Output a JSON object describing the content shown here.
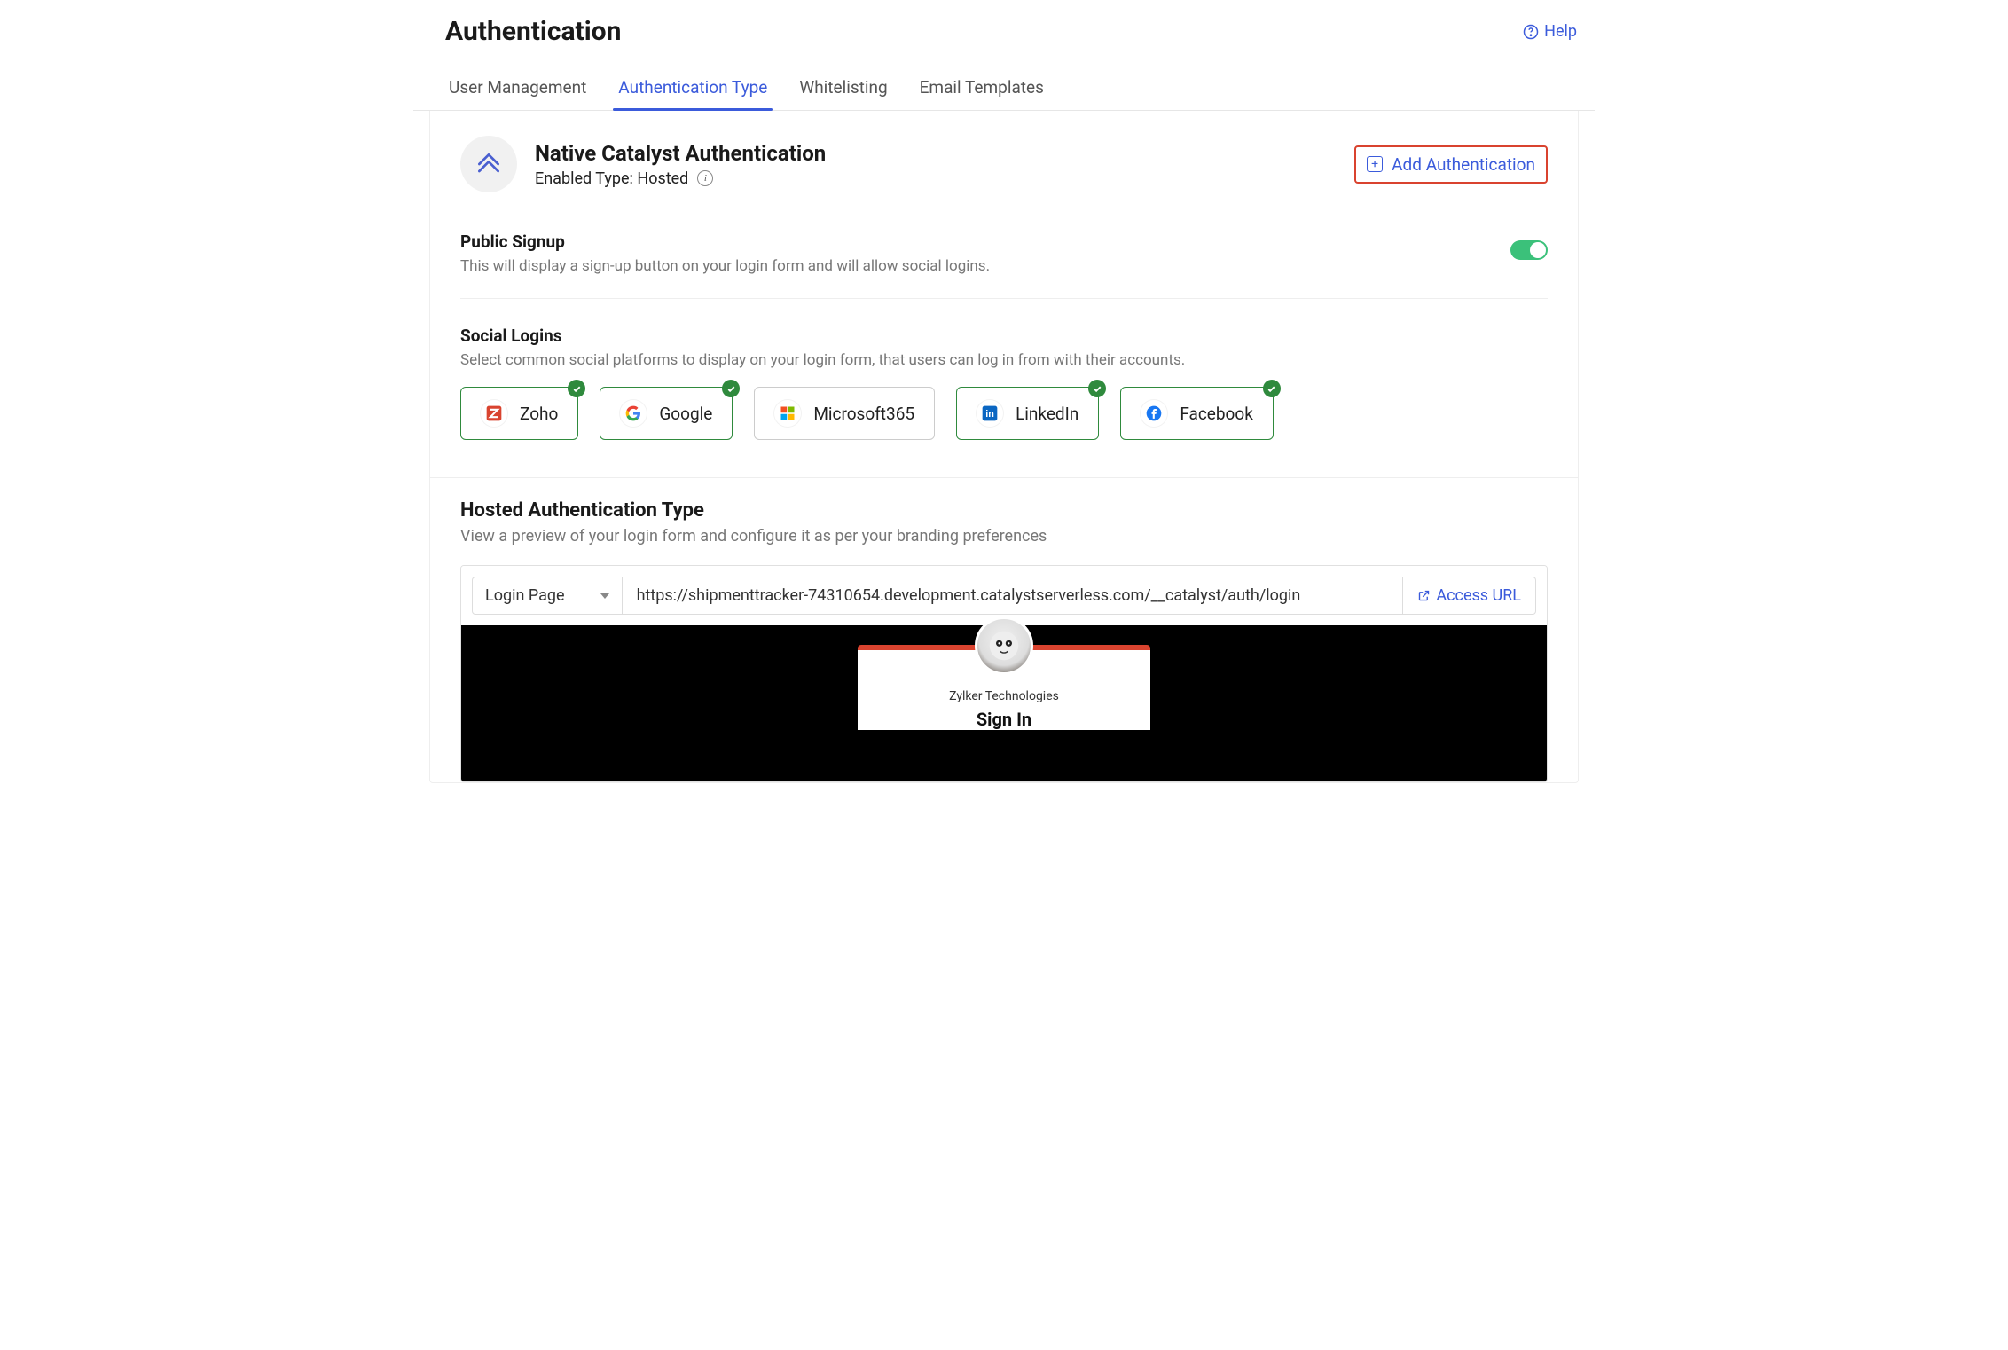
{
  "header": {
    "title": "Authentication",
    "help_label": "Help"
  },
  "tabs": [
    {
      "label": "User Management",
      "active": false
    },
    {
      "label": "Authentication Type",
      "active": true
    },
    {
      "label": "Whitelisting",
      "active": false
    },
    {
      "label": "Email Templates",
      "active": false
    }
  ],
  "card": {
    "title": "Native Catalyst Authentication",
    "subtitle": "Enabled Type: Hosted",
    "add_button": "Add Authentication"
  },
  "public_signup": {
    "title": "Public Signup",
    "description": "This will display a sign-up button on your login form and will allow social logins.",
    "enabled": true
  },
  "social_logins": {
    "title": "Social Logins",
    "description": "Select common social platforms to display on your login form, that users can log in from with their accounts.",
    "providers": [
      {
        "name": "Zoho",
        "selected": true,
        "icon": "zoho"
      },
      {
        "name": "Google",
        "selected": true,
        "icon": "google"
      },
      {
        "name": "Microsoft365",
        "selected": false,
        "icon": "microsoft"
      },
      {
        "name": "LinkedIn",
        "selected": true,
        "icon": "linkedin"
      },
      {
        "name": "Facebook",
        "selected": true,
        "icon": "facebook"
      }
    ]
  },
  "hosted": {
    "title": "Hosted Authentication Type",
    "description": "View a preview of your login form and configure it as per your branding preferences",
    "page_select": "Login Page",
    "url": "https://shipmenttracker-74310654.development.catalystserverless.com/__catalyst/auth/login",
    "access_label": "Access URL",
    "preview": {
      "company": "Zylker Technologies",
      "signin": "Sign In"
    }
  }
}
